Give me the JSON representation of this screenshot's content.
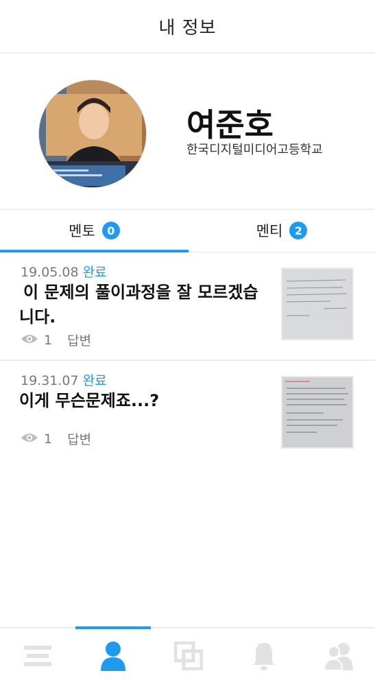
{
  "header": {
    "title": "내 정보"
  },
  "profile": {
    "name": "여준호",
    "school": "한국디지털미디어고등학교"
  },
  "tabs": [
    {
      "label": "멘토",
      "count": "0",
      "active": true
    },
    {
      "label": "멘티",
      "count": "2",
      "active": false
    }
  ],
  "posts": [
    {
      "date": "19.05.08",
      "status": "완료",
      "title": "이 문제의 풀이과정을 잘 모르겠습니다.",
      "views": "1",
      "answer_label": "답변"
    },
    {
      "date": "19.31.07",
      "status": "완료",
      "title": "이게 무슨문제죠...?",
      "views": "1",
      "answer_label": "답변"
    }
  ],
  "bottom_nav": [
    {
      "icon": "list-icon",
      "active": false
    },
    {
      "icon": "user-icon",
      "active": true
    },
    {
      "icon": "scan-icon",
      "active": false
    },
    {
      "icon": "bell-icon",
      "active": false
    },
    {
      "icon": "users-icon",
      "active": false
    }
  ],
  "colors": {
    "accent": "#1e9bf0",
    "inactive_icon": "#e2e2e2"
  }
}
